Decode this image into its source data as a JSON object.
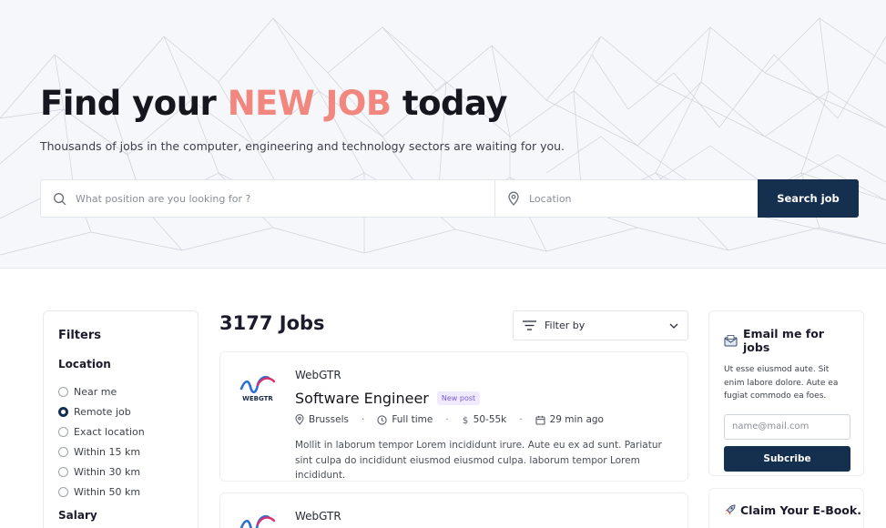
{
  "hero": {
    "title_pre": "Find your ",
    "title_accent": "NEW JOB",
    "title_post": " today",
    "subtitle": "Thousands of jobs in the computer, engineering and technology sectors are waiting for you.",
    "accent_color": "#f2877f"
  },
  "search": {
    "position_placeholder": "What position are you looking for ?",
    "location_placeholder": "Location",
    "button_label": "Search job"
  },
  "filters": {
    "title": "Filters",
    "location_heading": "Location",
    "location_options": [
      {
        "label": "Near me",
        "checked": false
      },
      {
        "label": "Remote job",
        "checked": true
      },
      {
        "label": "Exact location",
        "checked": false
      },
      {
        "label": "Within 15 km",
        "checked": false
      },
      {
        "label": "Within 30 km",
        "checked": false
      },
      {
        "label": "Within 50 km",
        "checked": false
      }
    ],
    "salary_heading": "Salary"
  },
  "results": {
    "count_label": "3177 Jobs",
    "filter_by_label": "Filter by"
  },
  "jobs": [
    {
      "company": "WebGTR",
      "logo_text": "WEBGTR",
      "title": "Software Engineer",
      "badge": "New post",
      "location": "Brussels",
      "type": "Full time",
      "salary": "50-55k",
      "posted": "29 min ago",
      "description": "Mollit in laborum tempor Lorem incididunt irure. Aute eu ex ad sunt. Pariatur sint culpa do incididunt eiusmod eiusmod culpa. laborum tempor Lorem incididunt."
    },
    {
      "company": "WebGTR"
    }
  ],
  "email_jobs": {
    "title": "Email me for jobs",
    "text": "Ut esse eiusmod aute. Sit enim labore dolore. Aute ea fugiat commodo ea foes.",
    "email_placeholder": "name@mail.com",
    "button_label": "Subcribe"
  },
  "ebook": {
    "title": "Claim Your E-Book."
  },
  "colors": {
    "primary": "#15304f",
    "badge_text": "#7a5cd6",
    "badge_bg": "#efeafd"
  }
}
